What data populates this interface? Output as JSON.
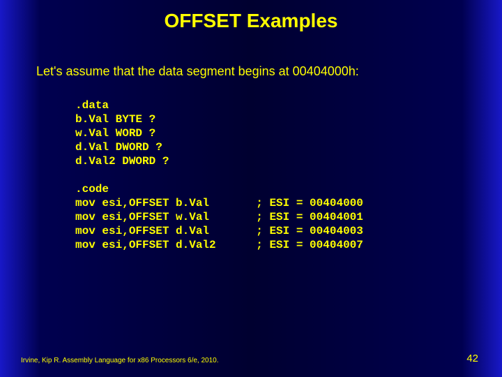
{
  "title": "OFFSET Examples",
  "intro": "Let's assume that the data segment begins at 00404000h:",
  "code_block": ".data\nb.Val BYTE ?\nw.Val WORD ?\nd.Val DWORD ?\nd.Val2 DWORD ?\n\n.code\nmov esi,OFFSET b.Val       ; ESI = 00404000\nmov esi,OFFSET w.Val       ; ESI = 00404001\nmov esi,OFFSET d.Val       ; ESI = 00404003\nmov esi,OFFSET d.Val2      ; ESI = 00404007",
  "footer": "Irvine, Kip R. Assembly Language for x86 Processors 6/e, 2010.",
  "page_number": "42"
}
